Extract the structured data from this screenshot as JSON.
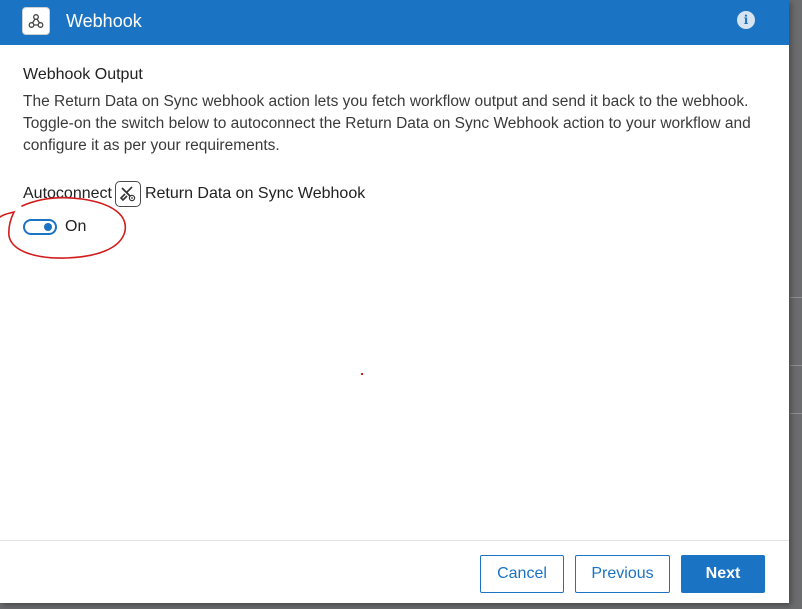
{
  "header": {
    "title": "Webhook",
    "icon": "webhook-icon",
    "info_icon": "info-icon",
    "info_glyph": "i",
    "color": "#1b73c3"
  },
  "section": {
    "title": "Webhook Output",
    "description_lines": [
      "The Return Data on Sync webhook action lets you fetch workflow output and send it back to the webhook.",
      "Toggle-on the switch below to autoconnect the Return Data on Sync Webhook action to your workflow and",
      "configure it as per your requirements."
    ]
  },
  "autoconnect": {
    "label": "Autoconnect",
    "action_icon": "tools-icon",
    "action_name": "Return Data on Sync Webhook",
    "toggle_state": "On",
    "toggle_on": true
  },
  "annotation": {
    "color": "#d21b1b"
  },
  "footer": {
    "cancel_label": "Cancel",
    "previous_label": "Previous",
    "next_label": "Next"
  }
}
